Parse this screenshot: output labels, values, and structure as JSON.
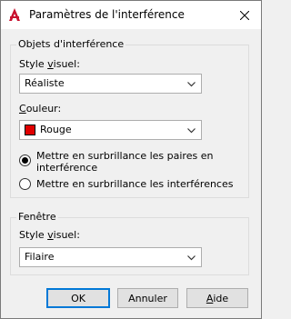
{
  "window": {
    "title": "Paramètres de l'interférence",
    "accent_color": "#c8102e"
  },
  "interference_objects": {
    "group_title": "Objets d'interférence",
    "visual_style_label": "Style visuel:",
    "visual_style_value": "Réaliste",
    "color_label": "Couleur:",
    "color_value": "Rouge",
    "color_swatch": "#e00000",
    "radio_pairs_line1": "Mettre en surbrillance les paires en",
    "radio_pairs_line2": "interférence",
    "radio_interferences": "Mettre en surbrillance les interférences",
    "selected_option": "radio_pairs"
  },
  "window_group": {
    "group_title": "Fenêtre",
    "visual_style_label": "Style visuel:",
    "visual_style_value": "Filaire"
  },
  "buttons": {
    "ok": "OK",
    "cancel": "Annuler",
    "help": "Aide"
  }
}
